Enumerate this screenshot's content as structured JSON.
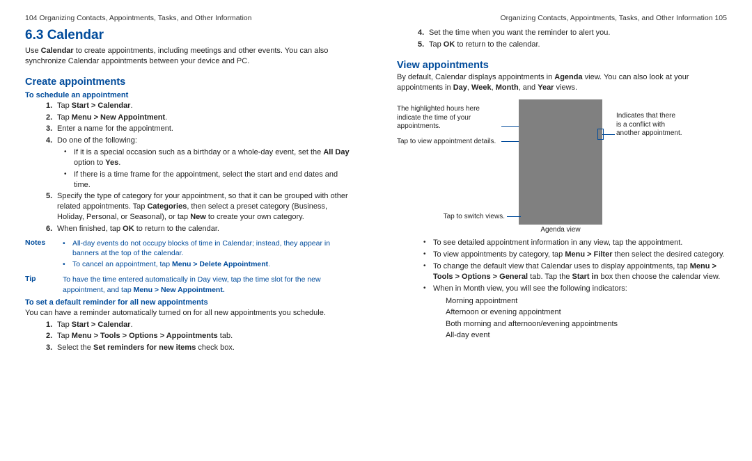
{
  "left": {
    "header": "104  Organizing Contacts, Appointments, Tasks, and Other Information",
    "title": "6.3  Calendar",
    "intro_pre": "Use ",
    "intro_bold": "Calendar",
    "intro_post": " to create appointments, including meetings and other events. You can also synchronize Calendar appointments between your device and PC.",
    "create_heading": "Create appointments",
    "schedule_heading": "To schedule an appointment",
    "step1_pre": "Tap ",
    "step1_b": "Start > Calendar",
    "step1_post": ".",
    "step2_pre": "Tap ",
    "step2_b": "Menu > New Appointment",
    "step2_post": ".",
    "step3": "Enter a name for the appointment.",
    "step4": "Do one of the following:",
    "step4a_pre": "If it is a special occasion such as a birthday or a whole-day event, set the ",
    "step4a_b": "All Day",
    "step4a_mid": " option to ",
    "step4a_b2": "Yes",
    "step4a_post": ".",
    "step4b": "If there is a time frame for the appointment, select the start and end dates and time.",
    "step5_pre": "Specify the type of category for your appointment, so that it can be grouped with other related appointments. Tap ",
    "step5_b": "Categories",
    "step5_mid": ", then select a preset category (Business, Holiday, Personal, or Seasonal), or tap ",
    "step5_b2": "New",
    "step5_post": " to create your own category.",
    "step6_pre": "When finished, tap ",
    "step6_b": "OK",
    "step6_post": " to return to the calendar.",
    "notes_label": "Notes",
    "note1": "All-day events do not occupy blocks of time in Calendar; instead, they appear in banners at the top of the calendar.",
    "note2_pre": "To cancel an appointment, tap ",
    "note2_b": "Menu > Delete Appointment",
    "note2_post": ".",
    "tip_label": "Tip",
    "tip_pre": "To have the time entered automatically in Day view, tap the time slot for the new appointment, and tap ",
    "tip_b": "Menu > New Appointment.",
    "reminder_heading": "To set a default reminder for all new appointments",
    "reminder_intro": "You can have a reminder automatically turned on for all new appointments you schedule.",
    "r1_pre": "Tap ",
    "r1_b": "Start > Calendar",
    "r1_post": ".",
    "r2_pre": "Tap ",
    "r2_b": "Menu > Tools > Options > Appointments",
    "r2_post": " tab.",
    "r3_pre": "Select the ",
    "r3_b": "Set reminders for new items",
    "r3_post": " check box."
  },
  "right": {
    "header": "Organizing Contacts, Appointments, Tasks, and Other Information  105",
    "step4": "Set the time when you want the reminder to alert you.",
    "step5_pre": "Tap ",
    "step5_b": "OK",
    "step5_post": " to return to the calendar.",
    "view_heading": "View appointments",
    "view_intro_pre": "By default, Calendar displays appointments in ",
    "view_intro_b1": "Agenda",
    "view_intro_mid": " view. You can also look at your appointments in ",
    "view_intro_b2": "Day",
    "c": ", ",
    "view_intro_b3": "Week",
    "view_intro_b4": "Month",
    "view_intro_and": ", and ",
    "view_intro_b5": "Year",
    "view_intro_post": " views.",
    "callout1": "The highlighted hours here indicate the time of your appointments.",
    "callout2": "Tap to view appointment details.",
    "callout3": "Tap to switch views.",
    "callout4": "Indicates that there is a conflict with another appointment.",
    "caption": "Agenda view",
    "b1": "To see detailed appointment information in any view, tap the appointment.",
    "b2_pre": "To view appointments by category, tap ",
    "b2_b": "Menu > Filter",
    "b2_post": " then select the desired category.",
    "b3_pre": "To change the default view that Calendar uses to display appointments, tap ",
    "b3_b": "Menu > Tools > Options > General",
    "b3_mid": " tab. Tap the ",
    "b3_b2": "Start in",
    "b3_post": " box then choose the calendar view.",
    "b4": "When in Month view, you will see the following indicators:",
    "ind1": "Morning appointment",
    "ind2": "Afternoon or evening appointment",
    "ind3": "Both morning and afternoon/evening appointments",
    "ind4": "All-day event"
  }
}
